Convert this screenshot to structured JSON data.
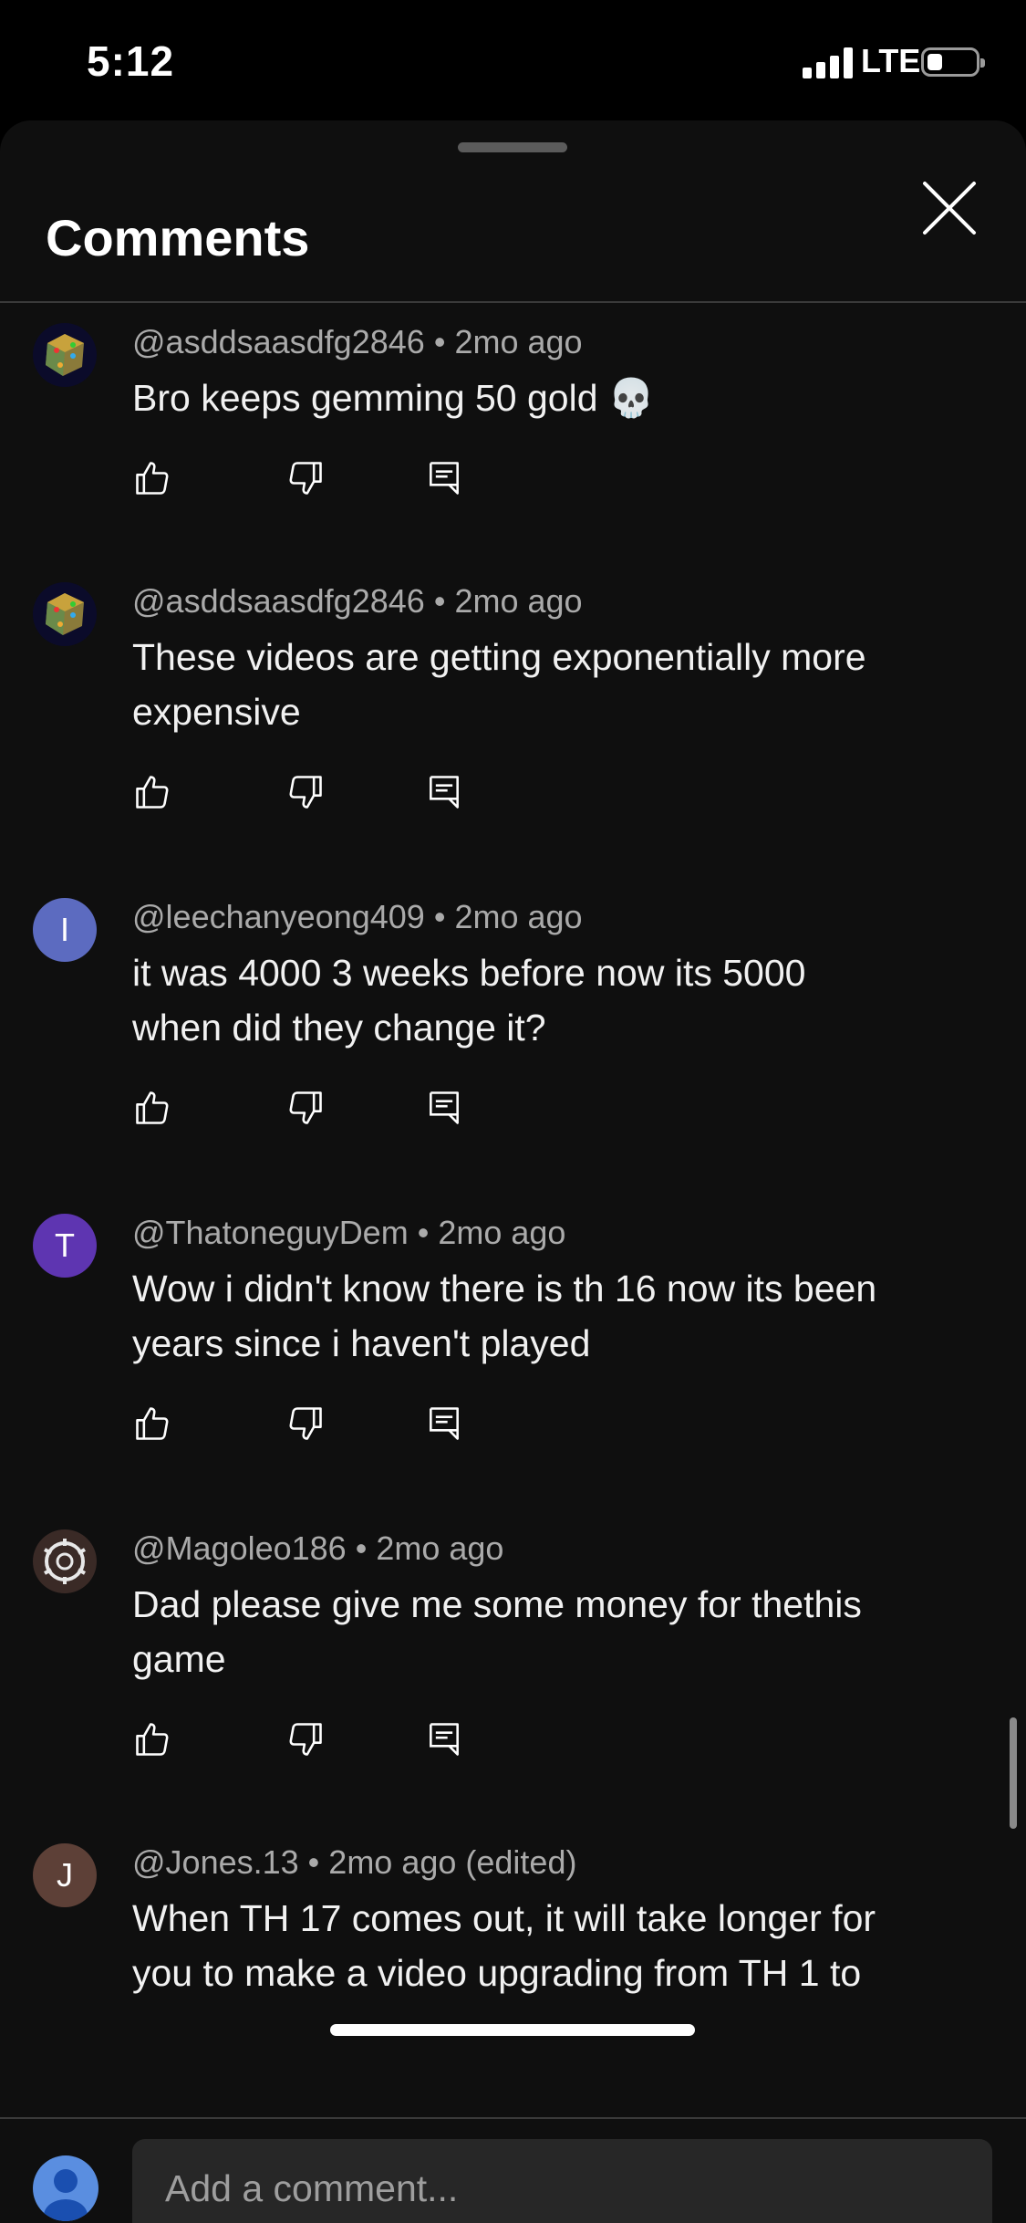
{
  "status": {
    "time": "5:12",
    "network": "LTE"
  },
  "header": {
    "title": "Comments"
  },
  "comments": [
    {
      "handle": "@asddsaasdfg2846",
      "time": "2mo ago",
      "line1": "Bro keeps gemming 50 gold 💀",
      "line2": "",
      "avatar_letter": "",
      "avatar_color": "#0b0b2a"
    },
    {
      "handle": "@asddsaasdfg2846",
      "time": "2mo ago",
      "line1": "These videos are getting exponentially more",
      "line2": "expensive",
      "avatar_letter": "",
      "avatar_color": "#0b0b2a"
    },
    {
      "handle": "@leechanyeong409",
      "time": "2mo ago",
      "line1": "it was 4000 3 weeks before now its 5000",
      "line2": "when did they change it?",
      "avatar_letter": "I",
      "avatar_color": "#5c6bc0"
    },
    {
      "handle": "@ThatoneguyDem",
      "time": "2mo ago",
      "line1": "Wow i didn't know there is th 16 now its been",
      "line2": "years since i haven't played",
      "avatar_letter": "T",
      "avatar_color": "#5e35b1"
    },
    {
      "handle": "@Magoleo186",
      "time": "2mo ago",
      "line1": "Dad please give me some money for thethis",
      "line2": "game",
      "avatar_letter": "",
      "avatar_color": "#2b2220"
    },
    {
      "handle": "@Jones.13",
      "time": "2mo ago (edited)",
      "line1": "When TH 17 comes out, it will take longer for",
      "line2": "you to make a video upgrading from TH 1 to",
      "avatar_letter": "J",
      "avatar_color": "#5d4037"
    }
  ],
  "separator": "•",
  "footer": {
    "placeholder": "Add a comment..."
  }
}
